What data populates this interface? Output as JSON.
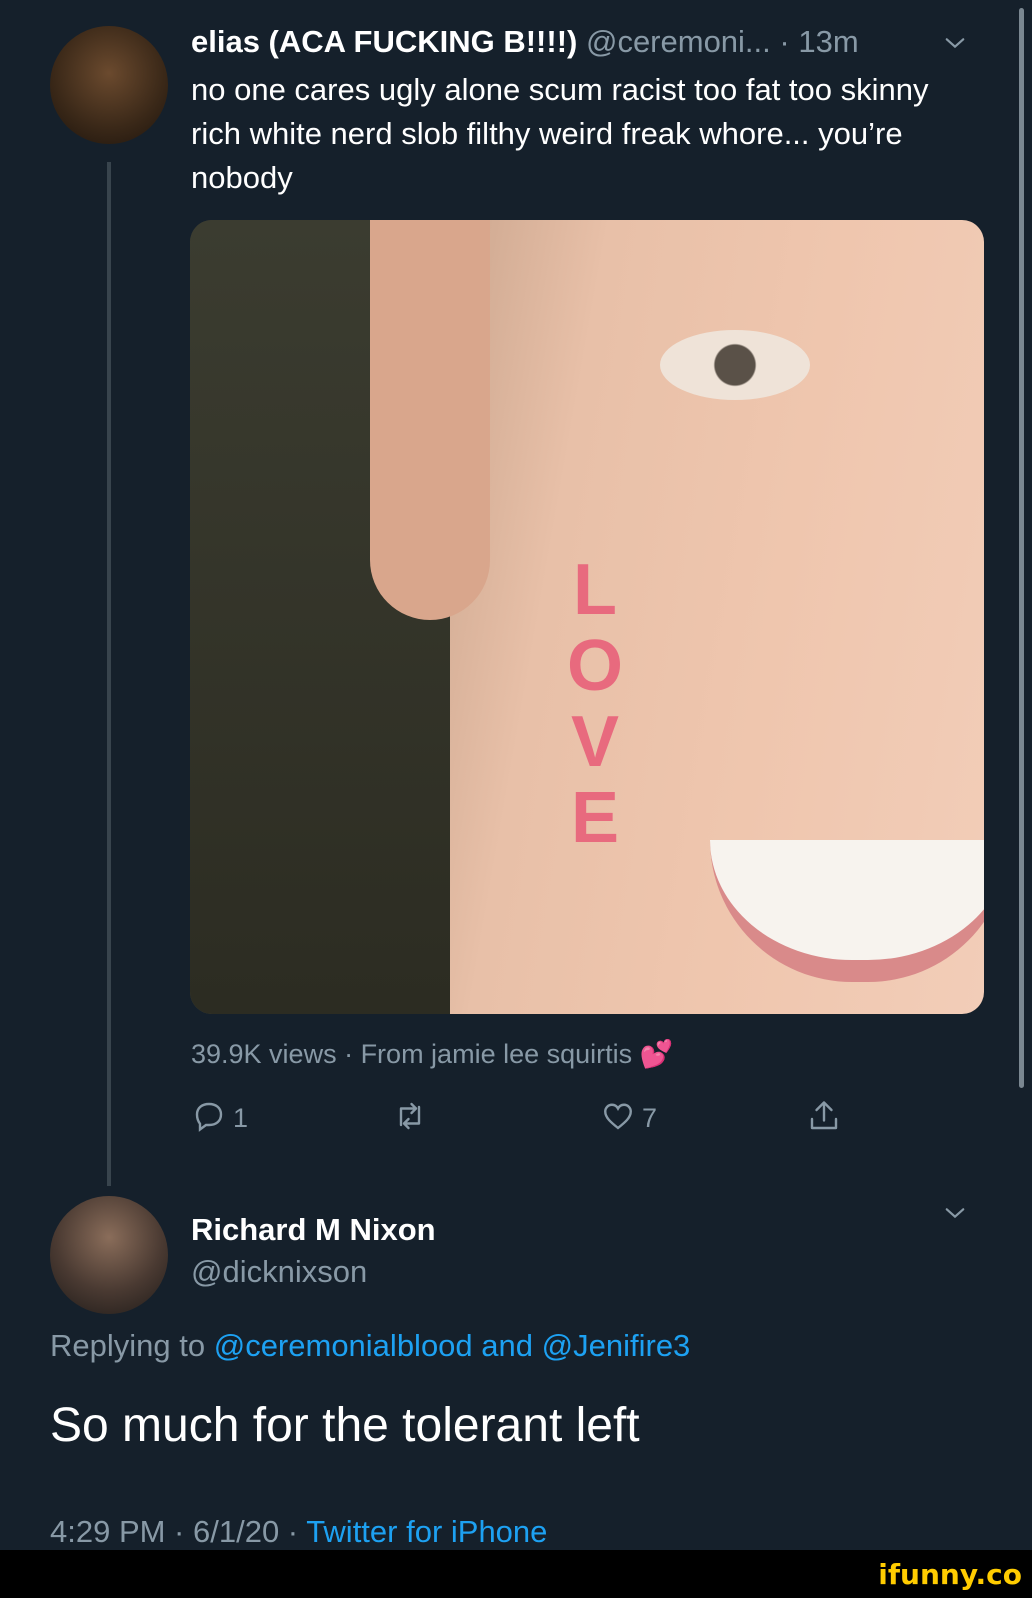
{
  "tweet1": {
    "name": "elias (ACA FUCKING B!!!!)",
    "handle": "@ceremoni...",
    "separator": "·",
    "time": "13m",
    "text": "no one cares ugly alone scum racist too fat too skinny rich white nerd slob filthy weird freak whore... you’re nobody",
    "media": {
      "overlay_text": "LOVE"
    },
    "views_line": "39.9K views · From jamie lee squirtis",
    "views_emoji": "💕",
    "actions": {
      "reply_icon": "reply-icon",
      "reply_count": "1",
      "retweet_icon": "retweet-icon",
      "like_icon": "like-icon",
      "like_count": "7",
      "share_icon": "share-icon"
    }
  },
  "tweet2": {
    "name": "Richard M Nixon",
    "handle": "@dicknixson",
    "replying_prefix": "Replying to",
    "replying_handle1": "@ceremonialblood",
    "replying_and": "and",
    "replying_handle2": "@Jenifire3",
    "text": "So much for the tolerant left",
    "time": "4:29 PM · 6/1/20 ·",
    "source": "Twitter for iPhone"
  },
  "watermark": "ifunny.co",
  "colors": {
    "background": "#15202b",
    "text": "#ffffff",
    "muted": "#8899a6",
    "link": "#1da1f2",
    "thread_line": "#38444d"
  }
}
